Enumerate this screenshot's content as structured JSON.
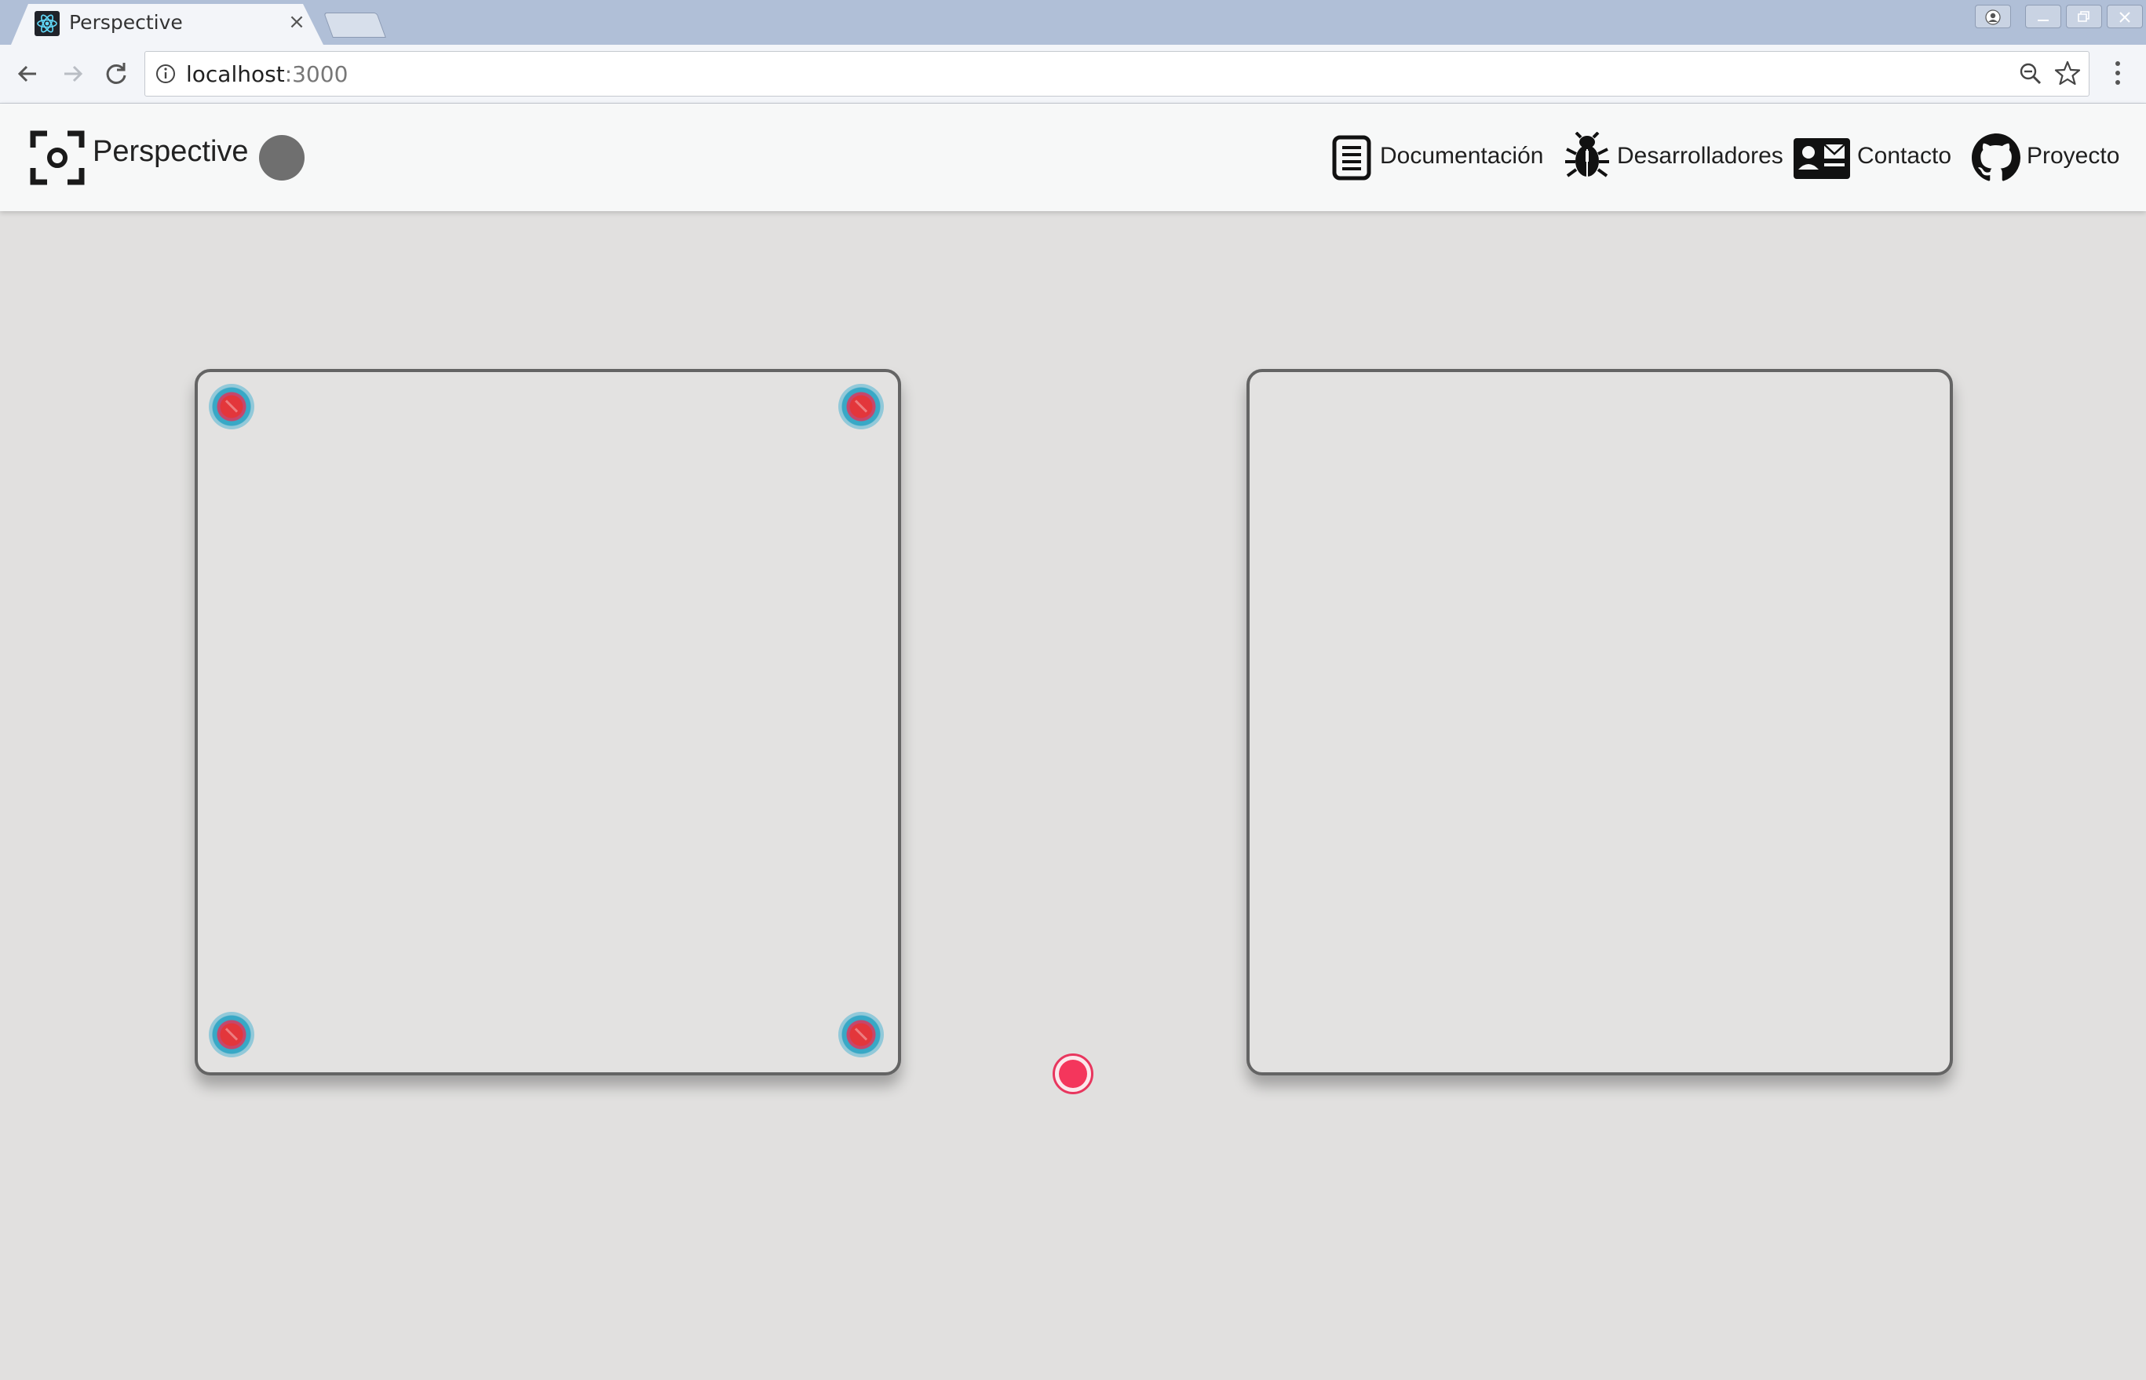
{
  "browser": {
    "tab_title": "Perspective",
    "tab_close": "×",
    "url_host": "localhost",
    "url_port": ":3000"
  },
  "app": {
    "brand": "Perspective",
    "status_color": "#6f6f6f",
    "nav": [
      {
        "label": "Documentación",
        "icon": "document-icon"
      },
      {
        "label": "Desarrolladores",
        "icon": "bug-icon"
      },
      {
        "label": "Contacto",
        "icon": "contact-card-icon"
      },
      {
        "label": "Proyecto",
        "icon": "github-icon"
      }
    ]
  },
  "canvas": {
    "panels": [
      "source-panel",
      "output-panel"
    ],
    "corner_handle_count": 4,
    "handle_color": "#38a8c6",
    "marker_color": "#f4365c"
  }
}
